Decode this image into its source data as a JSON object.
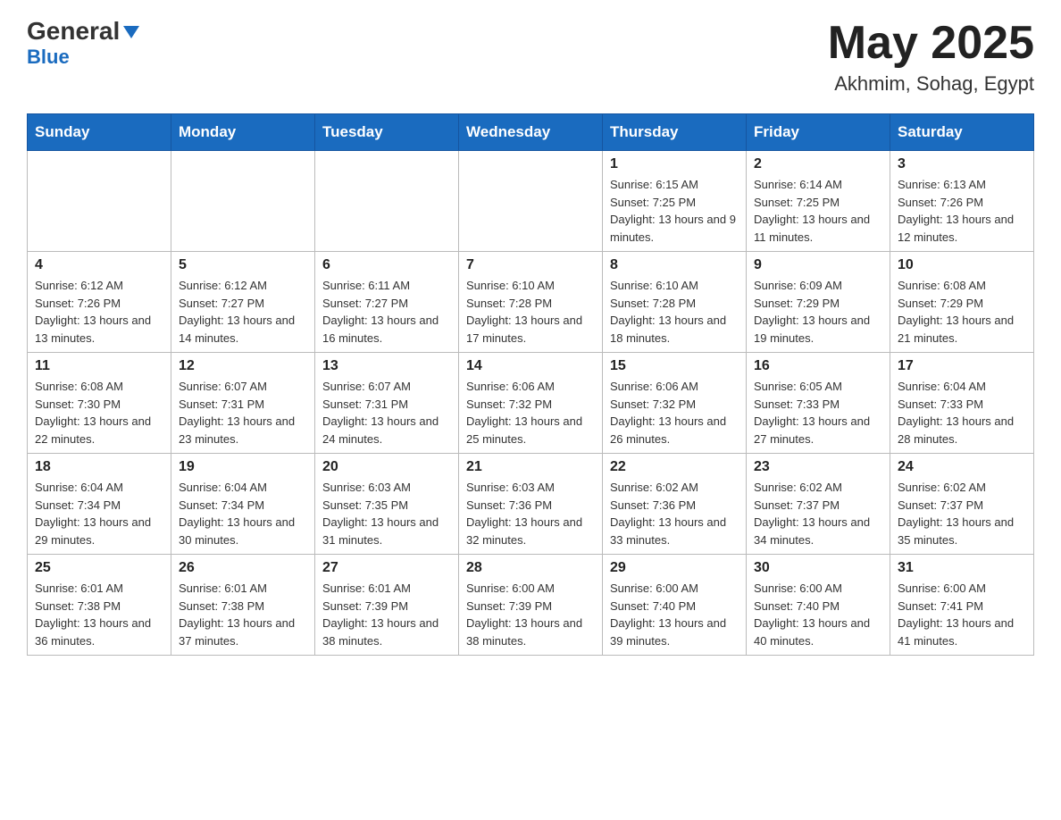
{
  "header": {
    "logo_main": "General",
    "logo_sub": "Blue",
    "title": "May 2025",
    "subtitle": "Akhmim, Sohag, Egypt"
  },
  "days_of_week": [
    "Sunday",
    "Monday",
    "Tuesday",
    "Wednesday",
    "Thursday",
    "Friday",
    "Saturday"
  ],
  "weeks": [
    [
      {
        "day": "",
        "info": ""
      },
      {
        "day": "",
        "info": ""
      },
      {
        "day": "",
        "info": ""
      },
      {
        "day": "",
        "info": ""
      },
      {
        "day": "1",
        "info": "Sunrise: 6:15 AM\nSunset: 7:25 PM\nDaylight: 13 hours and 9 minutes."
      },
      {
        "day": "2",
        "info": "Sunrise: 6:14 AM\nSunset: 7:25 PM\nDaylight: 13 hours and 11 minutes."
      },
      {
        "day": "3",
        "info": "Sunrise: 6:13 AM\nSunset: 7:26 PM\nDaylight: 13 hours and 12 minutes."
      }
    ],
    [
      {
        "day": "4",
        "info": "Sunrise: 6:12 AM\nSunset: 7:26 PM\nDaylight: 13 hours and 13 minutes."
      },
      {
        "day": "5",
        "info": "Sunrise: 6:12 AM\nSunset: 7:27 PM\nDaylight: 13 hours and 14 minutes."
      },
      {
        "day": "6",
        "info": "Sunrise: 6:11 AM\nSunset: 7:27 PM\nDaylight: 13 hours and 16 minutes."
      },
      {
        "day": "7",
        "info": "Sunrise: 6:10 AM\nSunset: 7:28 PM\nDaylight: 13 hours and 17 minutes."
      },
      {
        "day": "8",
        "info": "Sunrise: 6:10 AM\nSunset: 7:28 PM\nDaylight: 13 hours and 18 minutes."
      },
      {
        "day": "9",
        "info": "Sunrise: 6:09 AM\nSunset: 7:29 PM\nDaylight: 13 hours and 19 minutes."
      },
      {
        "day": "10",
        "info": "Sunrise: 6:08 AM\nSunset: 7:29 PM\nDaylight: 13 hours and 21 minutes."
      }
    ],
    [
      {
        "day": "11",
        "info": "Sunrise: 6:08 AM\nSunset: 7:30 PM\nDaylight: 13 hours and 22 minutes."
      },
      {
        "day": "12",
        "info": "Sunrise: 6:07 AM\nSunset: 7:31 PM\nDaylight: 13 hours and 23 minutes."
      },
      {
        "day": "13",
        "info": "Sunrise: 6:07 AM\nSunset: 7:31 PM\nDaylight: 13 hours and 24 minutes."
      },
      {
        "day": "14",
        "info": "Sunrise: 6:06 AM\nSunset: 7:32 PM\nDaylight: 13 hours and 25 minutes."
      },
      {
        "day": "15",
        "info": "Sunrise: 6:06 AM\nSunset: 7:32 PM\nDaylight: 13 hours and 26 minutes."
      },
      {
        "day": "16",
        "info": "Sunrise: 6:05 AM\nSunset: 7:33 PM\nDaylight: 13 hours and 27 minutes."
      },
      {
        "day": "17",
        "info": "Sunrise: 6:04 AM\nSunset: 7:33 PM\nDaylight: 13 hours and 28 minutes."
      }
    ],
    [
      {
        "day": "18",
        "info": "Sunrise: 6:04 AM\nSunset: 7:34 PM\nDaylight: 13 hours and 29 minutes."
      },
      {
        "day": "19",
        "info": "Sunrise: 6:04 AM\nSunset: 7:34 PM\nDaylight: 13 hours and 30 minutes."
      },
      {
        "day": "20",
        "info": "Sunrise: 6:03 AM\nSunset: 7:35 PM\nDaylight: 13 hours and 31 minutes."
      },
      {
        "day": "21",
        "info": "Sunrise: 6:03 AM\nSunset: 7:36 PM\nDaylight: 13 hours and 32 minutes."
      },
      {
        "day": "22",
        "info": "Sunrise: 6:02 AM\nSunset: 7:36 PM\nDaylight: 13 hours and 33 minutes."
      },
      {
        "day": "23",
        "info": "Sunrise: 6:02 AM\nSunset: 7:37 PM\nDaylight: 13 hours and 34 minutes."
      },
      {
        "day": "24",
        "info": "Sunrise: 6:02 AM\nSunset: 7:37 PM\nDaylight: 13 hours and 35 minutes."
      }
    ],
    [
      {
        "day": "25",
        "info": "Sunrise: 6:01 AM\nSunset: 7:38 PM\nDaylight: 13 hours and 36 minutes."
      },
      {
        "day": "26",
        "info": "Sunrise: 6:01 AM\nSunset: 7:38 PM\nDaylight: 13 hours and 37 minutes."
      },
      {
        "day": "27",
        "info": "Sunrise: 6:01 AM\nSunset: 7:39 PM\nDaylight: 13 hours and 38 minutes."
      },
      {
        "day": "28",
        "info": "Sunrise: 6:00 AM\nSunset: 7:39 PM\nDaylight: 13 hours and 38 minutes."
      },
      {
        "day": "29",
        "info": "Sunrise: 6:00 AM\nSunset: 7:40 PM\nDaylight: 13 hours and 39 minutes."
      },
      {
        "day": "30",
        "info": "Sunrise: 6:00 AM\nSunset: 7:40 PM\nDaylight: 13 hours and 40 minutes."
      },
      {
        "day": "31",
        "info": "Sunrise: 6:00 AM\nSunset: 7:41 PM\nDaylight: 13 hours and 41 minutes."
      }
    ]
  ]
}
